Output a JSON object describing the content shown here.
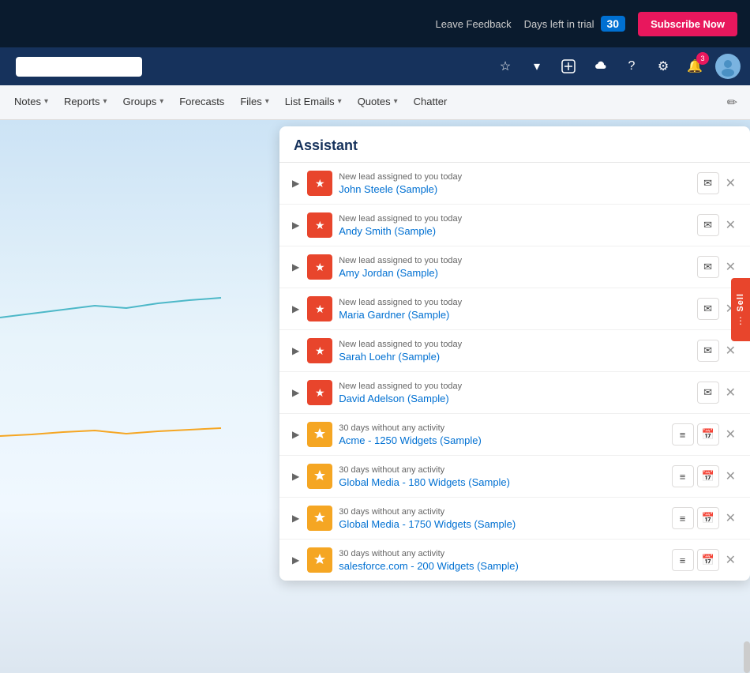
{
  "topbar": {
    "leave_feedback": "Leave Feedback",
    "days_left_label": "Days left in trial",
    "days_left_count": "30",
    "subscribe_btn": "Subscribe Now"
  },
  "iconbar": {
    "notif_count": "3"
  },
  "nav": {
    "items": [
      {
        "label": "Notes",
        "has_chevron": true
      },
      {
        "label": "Reports",
        "has_chevron": true
      },
      {
        "label": "Groups",
        "has_chevron": true
      },
      {
        "label": "Forecasts",
        "has_chevron": false
      },
      {
        "label": "Files",
        "has_chevron": true
      },
      {
        "label": "List Emails",
        "has_chevron": true
      },
      {
        "label": "Quotes",
        "has_chevron": true
      },
      {
        "label": "Chatter",
        "has_chevron": false
      }
    ],
    "search_placeholder": ""
  },
  "assistant": {
    "title": "Assistant",
    "leads": [
      {
        "subtitle": "New lead assigned to you today",
        "title": "John Steele (Sample)"
      },
      {
        "subtitle": "New lead assigned to you today",
        "title": "Andy Smith (Sample)"
      },
      {
        "subtitle": "New lead assigned to you today",
        "title": "Amy Jordan (Sample)"
      },
      {
        "subtitle": "New lead assigned to you today",
        "title": "Maria Gardner (Sample)"
      },
      {
        "subtitle": "New lead assigned to you today",
        "title": "Sarah Loehr (Sample)"
      },
      {
        "subtitle": "New lead assigned to you today",
        "title": "David Adelson (Sample)"
      }
    ],
    "opportunities": [
      {
        "subtitle": "30 days without any activity",
        "title": "Acme - 1250 Widgets (Sample)"
      },
      {
        "subtitle": "30 days without any activity",
        "title": "Global Media - 180 Widgets (Sample)"
      },
      {
        "subtitle": "30 days without any activity",
        "title": "Global Media - 1750 Widgets (Sample)"
      },
      {
        "subtitle": "30 days without any activity",
        "title": "salesforce.com - 200 Widgets (Sample)"
      }
    ]
  },
  "side_btn": {
    "label": "Sell"
  },
  "colors": {
    "lead_icon_bg": "#e8452c",
    "opportunity_icon_bg": "#f5a623",
    "subscribe_btn_bg": "#e8175d",
    "nav_bg": "#f4f6f9",
    "header_bg": "#0a1b2e",
    "icon_bar_bg": "#16325c"
  }
}
